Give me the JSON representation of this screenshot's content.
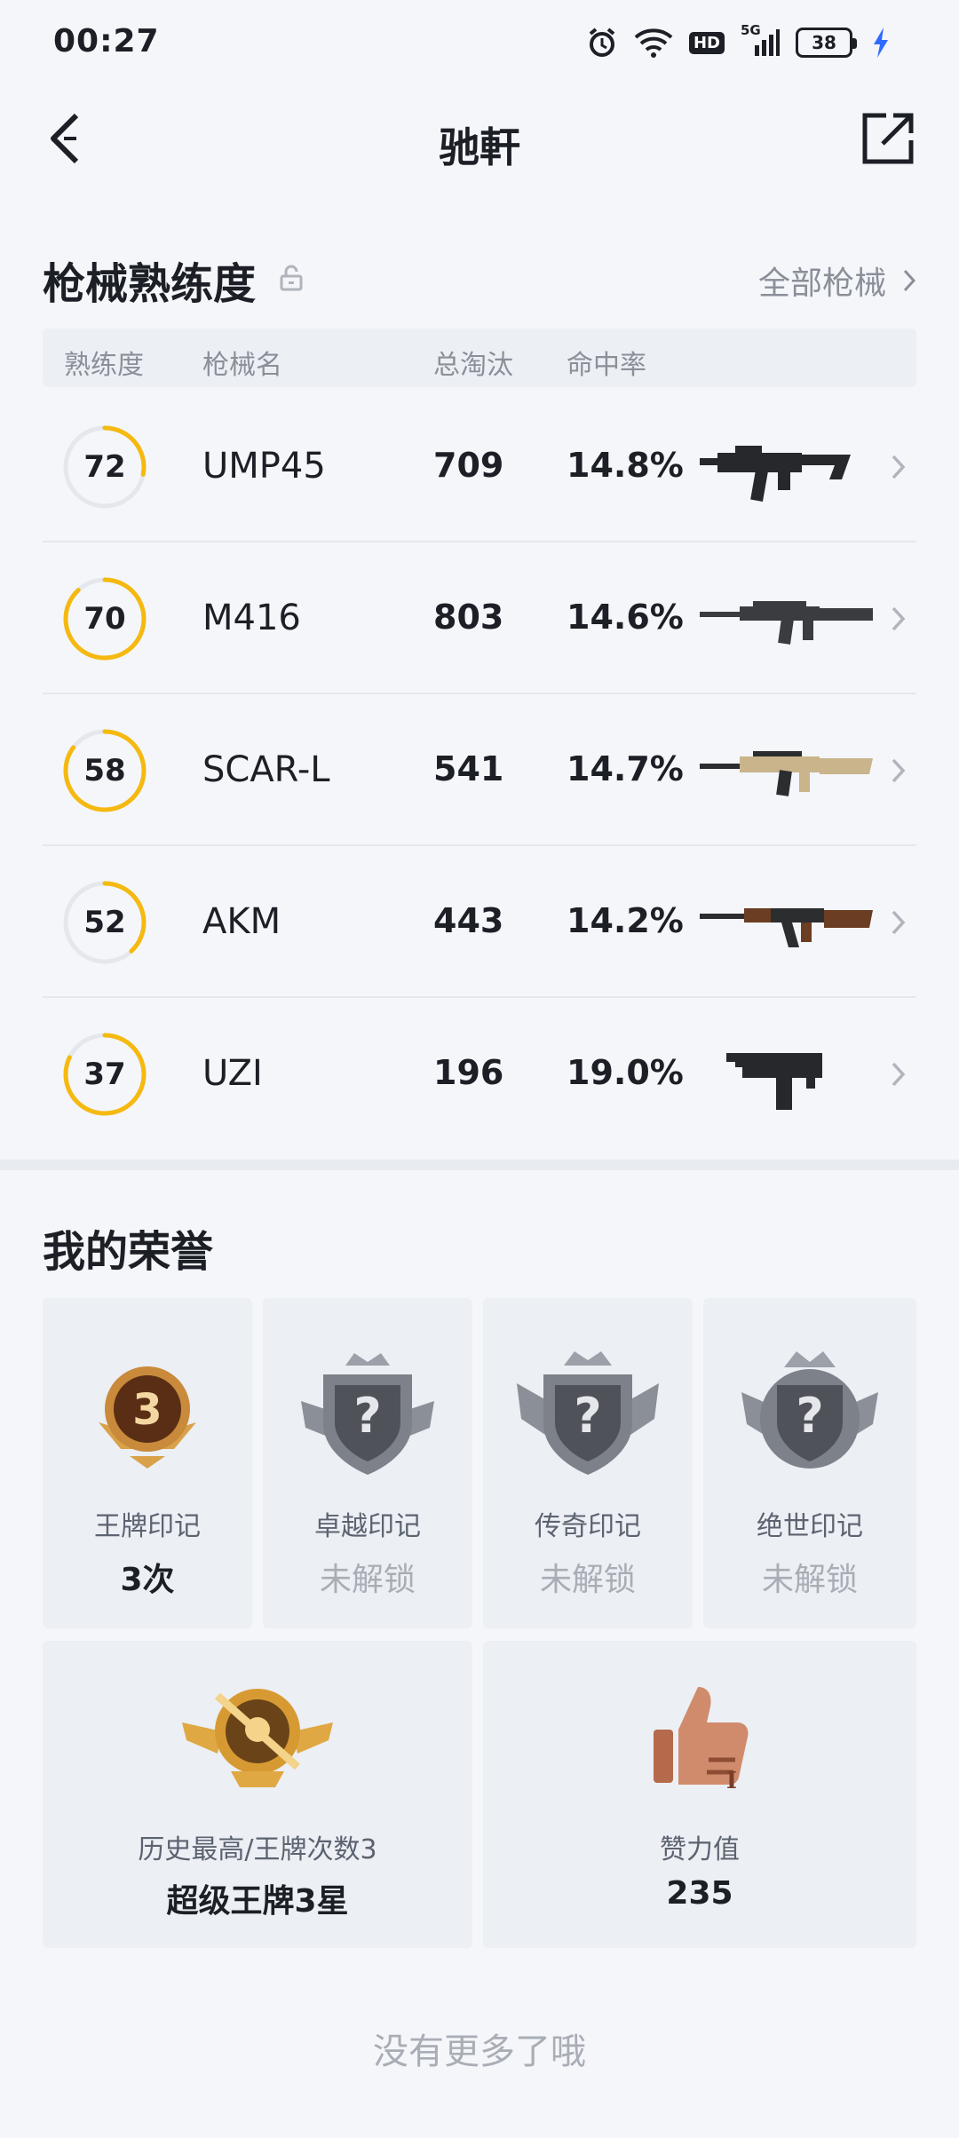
{
  "status_bar": {
    "time": "00:27",
    "hd": "HD",
    "network": "5G",
    "battery": "38"
  },
  "nav": {
    "title": "驰軒"
  },
  "weapons": {
    "section_title": "枪械熟练度",
    "all_link": "全部枪械",
    "headers": {
      "proficiency": "熟练度",
      "name": "枪械名",
      "kills": "总淘汰",
      "accuracy": "命中率"
    },
    "items": [
      {
        "proficiency": "72",
        "name": "UMP45",
        "kills": "709",
        "accuracy": "14.8%",
        "ring_fraction": 0.28,
        "icon": "smg-icon"
      },
      {
        "proficiency": "70",
        "name": "M416",
        "kills": "803",
        "accuracy": "14.6%",
        "ring_fraction": 0.88,
        "icon": "rifle-icon"
      },
      {
        "proficiency": "58",
        "name": "SCAR-L",
        "kills": "541",
        "accuracy": "14.7%",
        "ring_fraction": 0.85,
        "icon": "rifle-icon"
      },
      {
        "proficiency": "52",
        "name": "AKM",
        "kills": "443",
        "accuracy": "14.2%",
        "ring_fraction": 0.38,
        "icon": "rifle-icon"
      },
      {
        "proficiency": "37",
        "name": "UZI",
        "kills": "196",
        "accuracy": "19.0%",
        "ring_fraction": 0.82,
        "icon": "pistol-smg-icon"
      }
    ],
    "ring_color": "#f5b90f",
    "ring_track_color": "#e4e7ec"
  },
  "honors": {
    "section_title": "我的荣誉",
    "marks": [
      {
        "label": "王牌印记",
        "value": "3次",
        "locked": false,
        "badge_number": "3"
      },
      {
        "label": "卓越印记",
        "value": "未解锁",
        "locked": true
      },
      {
        "label": "传奇印记",
        "value": "未解锁",
        "locked": true
      },
      {
        "label": "绝世印记",
        "value": "未解锁",
        "locked": true
      }
    ],
    "highest": {
      "label": "历史最高/王牌次数3",
      "value": "超级王牌3星"
    },
    "likes": {
      "label": "赞力值",
      "value": "235"
    }
  },
  "footer": {
    "no_more": "没有更多了哦"
  }
}
